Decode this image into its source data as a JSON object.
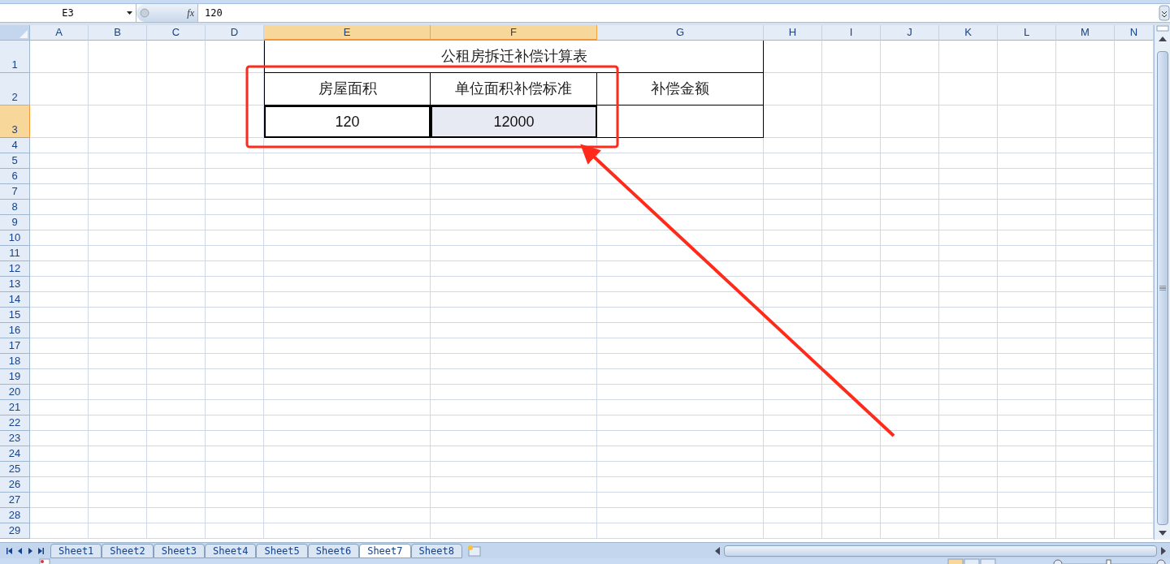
{
  "formula_bar": {
    "name_box": "E3",
    "function_label": "fx",
    "formula": "120"
  },
  "columns": [
    {
      "label": "A",
      "selected": false
    },
    {
      "label": "B",
      "selected": false
    },
    {
      "label": "C",
      "selected": false
    },
    {
      "label": "D",
      "selected": false
    },
    {
      "label": "E",
      "selected": true
    },
    {
      "label": "F",
      "selected": true
    },
    {
      "label": "G",
      "selected": false
    },
    {
      "label": "H",
      "selected": false
    },
    {
      "label": "I",
      "selected": false
    },
    {
      "label": "J",
      "selected": false
    },
    {
      "label": "K",
      "selected": false
    },
    {
      "label": "L",
      "selected": false
    },
    {
      "label": "M",
      "selected": false
    },
    {
      "label": "N",
      "selected": false
    }
  ],
  "rows": [
    {
      "label": "1",
      "selected": false
    },
    {
      "label": "2",
      "selected": false
    },
    {
      "label": "3",
      "selected": true
    },
    {
      "label": "4",
      "selected": false
    },
    {
      "label": "5",
      "selected": false
    },
    {
      "label": "6",
      "selected": false
    },
    {
      "label": "7",
      "selected": false
    },
    {
      "label": "8",
      "selected": false
    },
    {
      "label": "9",
      "selected": false
    },
    {
      "label": "10",
      "selected": false
    },
    {
      "label": "11",
      "selected": false
    },
    {
      "label": "12",
      "selected": false
    },
    {
      "label": "13",
      "selected": false
    },
    {
      "label": "14",
      "selected": false
    },
    {
      "label": "15",
      "selected": false
    },
    {
      "label": "16",
      "selected": false
    },
    {
      "label": "17",
      "selected": false
    },
    {
      "label": "18",
      "selected": false
    },
    {
      "label": "19",
      "selected": false
    },
    {
      "label": "20",
      "selected": false
    },
    {
      "label": "21",
      "selected": false
    },
    {
      "label": "22",
      "selected": false
    },
    {
      "label": "23",
      "selected": false
    },
    {
      "label": "24",
      "selected": false
    },
    {
      "label": "25",
      "selected": false
    },
    {
      "label": "26",
      "selected": false
    },
    {
      "label": "27",
      "selected": false
    },
    {
      "label": "28",
      "selected": false
    },
    {
      "label": "29",
      "selected": false
    }
  ],
  "table": {
    "title": "公租房拆迁补偿计算表",
    "headers": [
      "房屋面积",
      "单位面积补偿标准",
      "补偿金额"
    ],
    "values": [
      {
        "text": "120",
        "selected": true,
        "active": true
      },
      {
        "text": "12000",
        "selected": true,
        "active": false
      }
    ]
  },
  "sheets": [
    {
      "label": "Sheet1",
      "selected": false
    },
    {
      "label": "Sheet2",
      "selected": false
    },
    {
      "label": "Sheet3",
      "selected": false
    },
    {
      "label": "Sheet4",
      "selected": false
    },
    {
      "label": "Sheet5",
      "selected": false
    },
    {
      "label": "Sheet6",
      "selected": false
    },
    {
      "label": "Sheet7",
      "selected": true
    },
    {
      "label": "Sheet8",
      "selected": false
    }
  ]
}
